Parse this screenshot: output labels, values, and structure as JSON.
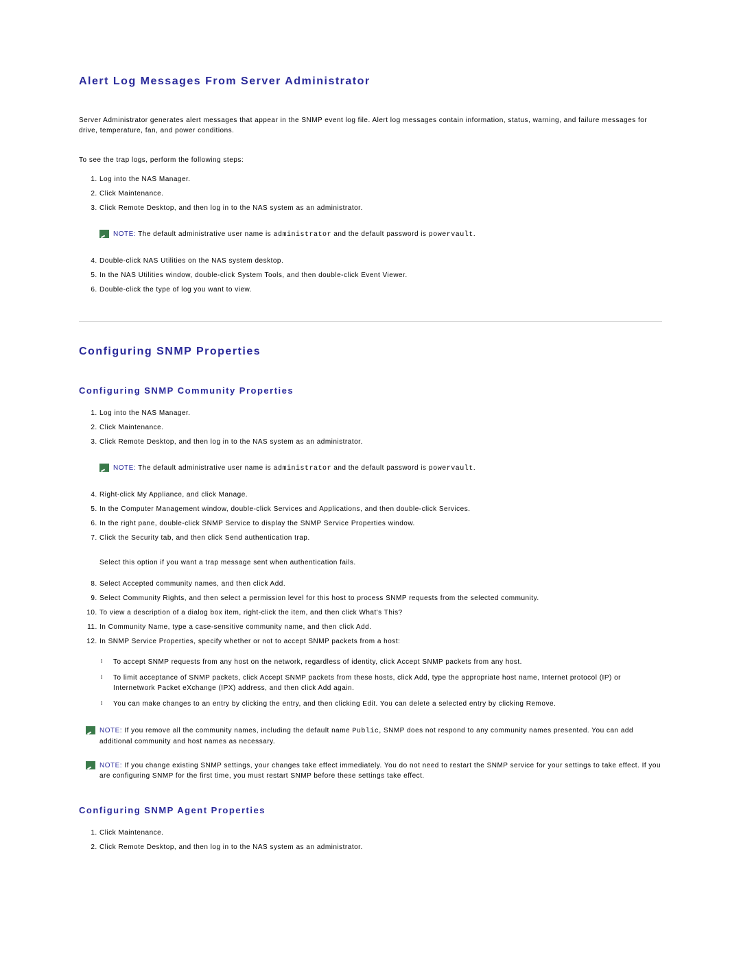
{
  "section1": {
    "title": "Alert Log Messages From Server Administrator",
    "intro": "Server Administrator generates alert messages that appear in the SNMP event log file. Alert log messages contain information, status, warning, and failure messages for drive, temperature, fan, and power conditions.",
    "lead": "To see the trap logs, perform the following steps:",
    "steps_a": [
      "Log into the NAS Manager.",
      "Click Maintenance.",
      "Click Remote Desktop, and then log in to the NAS system as an administrator."
    ],
    "note1": {
      "label": "NOTE:",
      "pre": " The default administrative user name is ",
      "code1": "administrator",
      "mid": " and the default password is ",
      "code2": "powervault",
      "post": "."
    },
    "steps_b": [
      "Double-click NAS Utilities on the NAS system desktop.",
      "In the NAS Utilities window, double-click System Tools, and then double-click Event Viewer.",
      "Double-click the type of log you want to view."
    ]
  },
  "section2": {
    "title": "Configuring SNMP Properties",
    "sub1": {
      "title": "Configuring SNMP Community Properties",
      "steps_a": [
        "Log into the NAS Manager.",
        "Click Maintenance.",
        "Click Remote Desktop, and then log in to the NAS system as an administrator."
      ],
      "note1": {
        "label": "NOTE:",
        "pre": " The default administrative user name is ",
        "code1": "administrator",
        "mid": " and the default password is ",
        "code2": "powervault",
        "post": "."
      },
      "steps_b": [
        "Right-click My Appliance, and click Manage.",
        "In the Computer Management window, double-click Services and Applications, and then double-click Services.",
        "In the right pane, double-click SNMP Service to display the SNMP Service Properties window.",
        "Click the Security tab, and then click Send authentication trap."
      ],
      "sub_para": "Select this option if you want a trap message sent when authentication fails.",
      "steps_c": [
        "Select Accepted community names, and then click Add.",
        "Select Community Rights, and then select a permission level for this host to process SNMP requests from the selected community.",
        "To view a description of a dialog box item, right-click the item, and then click What's This?",
        "In Community Name, type a case-sensitive community name, and then click Add.",
        "In SNMP Service Properties, specify whether or not to accept SNMP packets from a host:"
      ],
      "bullets": [
        "To accept SNMP requests from any host on the network, regardless of identity, click Accept SNMP packets from any host.",
        "To limit acceptance of SNMP packets, click Accept SNMP packets from these hosts, click Add, type the appropriate host name, Internet protocol (IP) or Internetwork Packet eXchange (IPX) address, and then click Add again.",
        "You can make changes to an entry by clicking the entry, and then clicking Edit. You can delete a selected entry by clicking Remove."
      ],
      "note2": {
        "label": "NOTE:",
        "pre": " If you remove all the community names, including the default name ",
        "code1": "Public",
        "post": ", SNMP does not respond to any community names presented. You can add additional community and host names as necessary."
      },
      "note3": {
        "label": "NOTE:",
        "text": " If you change existing SNMP settings, your changes take effect immediately. You do not need to restart the SNMP service for your settings to take effect. If you are configuring SNMP for the first time, you must restart SNMP before these settings take effect."
      }
    },
    "sub2": {
      "title": "Configuring SNMP Agent Properties",
      "steps": [
        "Click Maintenance.",
        "Click Remote Desktop, and then log in to the NAS system as an administrator."
      ]
    }
  }
}
